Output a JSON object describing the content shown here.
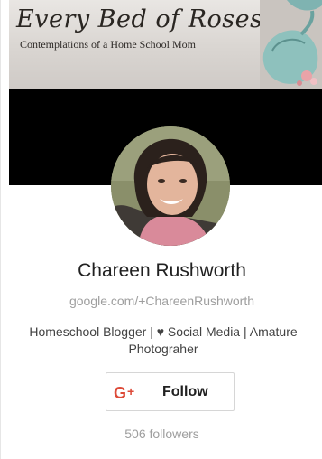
{
  "banner": {
    "title": "Every Bed of Roses",
    "subtitle": "Contemplations of  a Home School Mom"
  },
  "profile": {
    "name": "Chareen Rushworth",
    "url": "google.com/+ChareenRushworth",
    "tagline": "Homeschool Blogger | ♥ Social Media | Amature Photograher",
    "followers": "506 followers"
  },
  "follow_button": {
    "icon_text": "G+",
    "label": "Follow"
  },
  "colors": {
    "gplus_red": "#dd4b39",
    "black_band": "#000000"
  }
}
